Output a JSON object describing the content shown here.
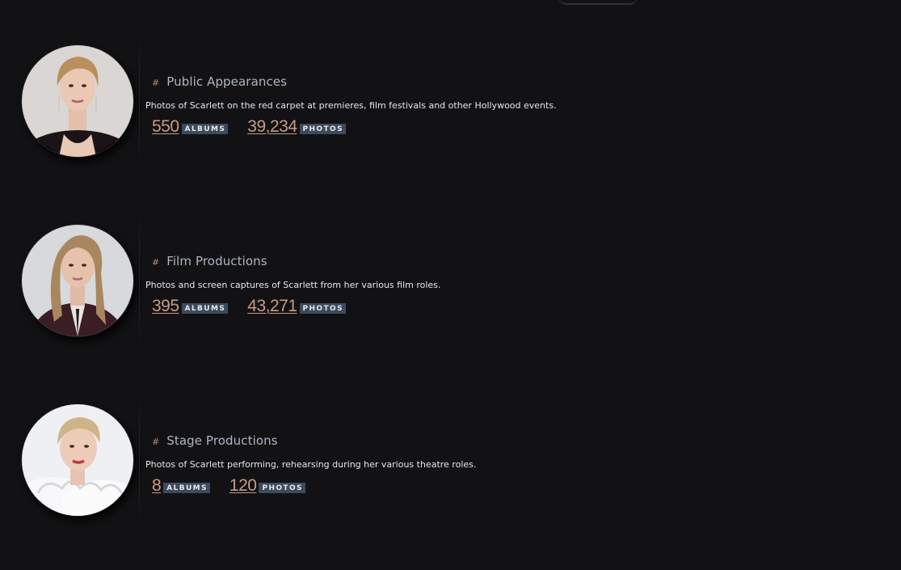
{
  "categories": [
    {
      "title": "Public Appearances",
      "description": "Photos of Scarlett on the red carpet at premieres, film festivals and other Hollywood events.",
      "albums_count": "550",
      "albums_label": "ALBUMS",
      "photos_count": "39,234",
      "photos_label": "PHOTOS"
    },
    {
      "title": "Film Productions",
      "description": "Photos and screen captures of Scarlett from her various film roles.",
      "albums_count": "395",
      "albums_label": "ALBUMS",
      "photos_count": "43,271",
      "photos_label": "PHOTOS"
    },
    {
      "title": "Stage Productions",
      "description": "Photos of Scarlett performing, rehearsing during her various theatre roles.",
      "albums_count": "8",
      "albums_label": "ALBUMS",
      "photos_count": "120",
      "photos_label": "PHOTOS"
    }
  ],
  "colors": {
    "background": "#121214",
    "title": "#aeb5c4",
    "count": "#c99a84",
    "badge": "#3c4a5c",
    "hash": "#b08b78"
  },
  "icons": {
    "heading_marker": "hash-icon"
  }
}
